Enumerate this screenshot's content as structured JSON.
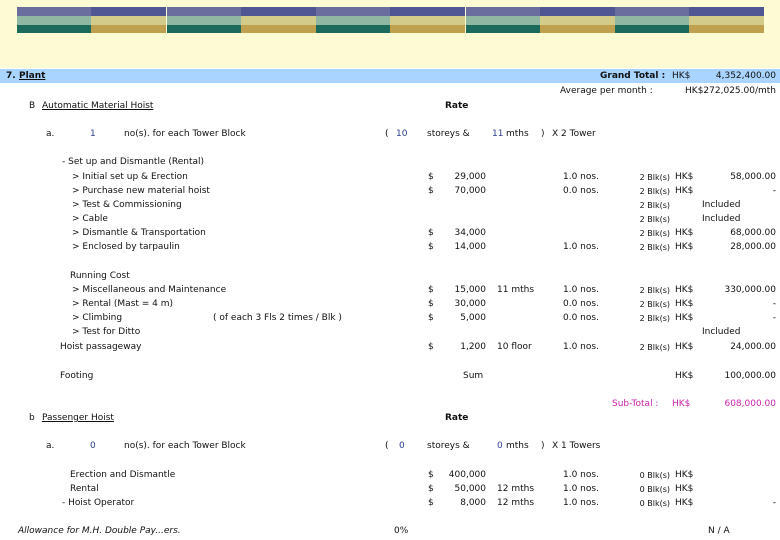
{
  "section": {
    "number": "7.",
    "name": "Plant",
    "grand_total_label": "Grand Total :",
    "grand_total_currency": "HK$",
    "grand_total_value": "4,352,400.00",
    "avg_label": "Average per month :",
    "avg_value": "HK$272,025.00/mth"
  },
  "hoist_b": {
    "title_prefix": "B",
    "title": "Automatic Material Hoist",
    "rate_header": "Rate",
    "spec": {
      "prefix": "a.",
      "count": "1",
      "text": "no(s). for each Tower Block",
      "paren_open": "(",
      "storeys_num": "10",
      "storeys": "storeys &",
      "mths_num": "11",
      "mths": "mths",
      "paren_close": ")",
      "towers": "X 2 Tower"
    },
    "setup_heading": "- Set up and Dismantle (Rental)",
    "rows": [
      {
        "label": "> Initial set up & Erection",
        "cur": "$",
        "rate": "29,000",
        "dur": "",
        "qty": "1.0 nos.",
        "blks": "2 Blk(s)",
        "cur2": "HK$",
        "amount": "58,000.00"
      },
      {
        "label": "> Purchase new material hoist",
        "cur": "$",
        "rate": "70,000",
        "dur": "",
        "qty": "0.0 nos.",
        "blks": "2 Blk(s)",
        "cur2": "HK$",
        "amount": "-"
      },
      {
        "label": "> Test & Commissioning",
        "cur": "",
        "rate": "",
        "dur": "",
        "qty": "",
        "blks": "2 Blk(s)",
        "cur2": "",
        "amount": "Included"
      },
      {
        "label": "> Cable",
        "cur": "",
        "rate": "",
        "dur": "",
        "qty": "",
        "blks": "2 Blk(s)",
        "cur2": "",
        "amount": "Included"
      },
      {
        "label": "> Dismantle & Transportation",
        "cur": "$",
        "rate": "34,000",
        "dur": "",
        "qty": "",
        "blks": "2 Blk(s)",
        "cur2": "HK$",
        "amount": "68,000.00"
      },
      {
        "label": "> Enclosed by tarpaulin",
        "cur": "$",
        "rate": "14,000",
        "dur": "",
        "qty": "1.0 nos.",
        "blks": "2 Blk(s)",
        "cur2": "HK$",
        "amount": "28,000.00"
      }
    ],
    "running_heading": "Running Cost",
    "running_rows": [
      {
        "label": "> Miscellaneous and Maintenance",
        "cur": "$",
        "rate": "15,000",
        "dur": "11 mths",
        "qty": "1.0 nos.",
        "blks": "2 Blk(s)",
        "cur2": "HK$",
        "amount": "330,000.00"
      },
      {
        "label": "> Rental (Mast = 4 m)",
        "cur": "$",
        "rate": "30,000",
        "dur": "",
        "qty": "0.0 nos.",
        "blks": "2 Blk(s)",
        "cur2": "HK$",
        "amount": "-"
      },
      {
        "label": "> Climbing",
        "cur": "$",
        "rate": "5,000",
        "dur": "",
        "qty": "0.0 nos.",
        "blks": "2 Blk(s)",
        "cur2": "HK$",
        "amount": "-"
      },
      {
        "label": "> Test for Ditto",
        "cur": "",
        "rate": "",
        "dur": "",
        "qty": "",
        "blks": "",
        "cur2": "",
        "amount": "Included"
      }
    ],
    "climbing_note": "( of each 3 Fls    2 times / Blk )",
    "gangway": {
      "label": "Hoist passageway",
      "cur": "$",
      "rate": "1,200",
      "dur": "10 floor",
      "qty": "1.0 nos.",
      "blks": "2 Blk(s)",
      "cur2": "HK$",
      "amount": "24,000.00"
    },
    "footing": {
      "label": "Footing",
      "rate": "Sum",
      "cur2": "HK$",
      "amount": "100,000.00"
    },
    "subtotal": {
      "label": "Sub-Total :",
      "cur": "HK$",
      "value": "608,000.00"
    }
  },
  "hoist_b2": {
    "title_prefix": "b",
    "title": "Passenger Hoist",
    "rate_header": "Rate",
    "spec": {
      "prefix": "a.",
      "count": "0",
      "text": "no(s). for each Tower Block",
      "paren_open": "(",
      "storeys_num": "0",
      "storeys": "storeys &",
      "mths_num": "0",
      "mths": "mths",
      "paren_close": ")",
      "towers": "X 1 Towers"
    },
    "rows": [
      {
        "label": "Erection and Dismantle",
        "cur": "$",
        "rate": "400,000",
        "dur": "",
        "qty": "1.0 nos.",
        "blks": "0 Blk(s)",
        "cur2": "HK$",
        "amount": ""
      },
      {
        "label": "Rental",
        "cur": "$",
        "rate": "50,000",
        "dur": "12 mths",
        "qty": "1.0 nos.",
        "blks": "0 Blk(s)",
        "cur2": "HK$",
        "amount": ""
      },
      {
        "label": "- Hoist Operator",
        "cur": "$",
        "rate": "8,000",
        "dur": "12 mths",
        "qty": "1.0 nos.",
        "blks": "0 Blk(s)",
        "cur2": "HK$",
        "amount": "-"
      }
    ]
  },
  "allowance": {
    "label": "Allowance for M.H. Double Pay...ers.",
    "pct": "0%",
    "value": "N / A"
  }
}
